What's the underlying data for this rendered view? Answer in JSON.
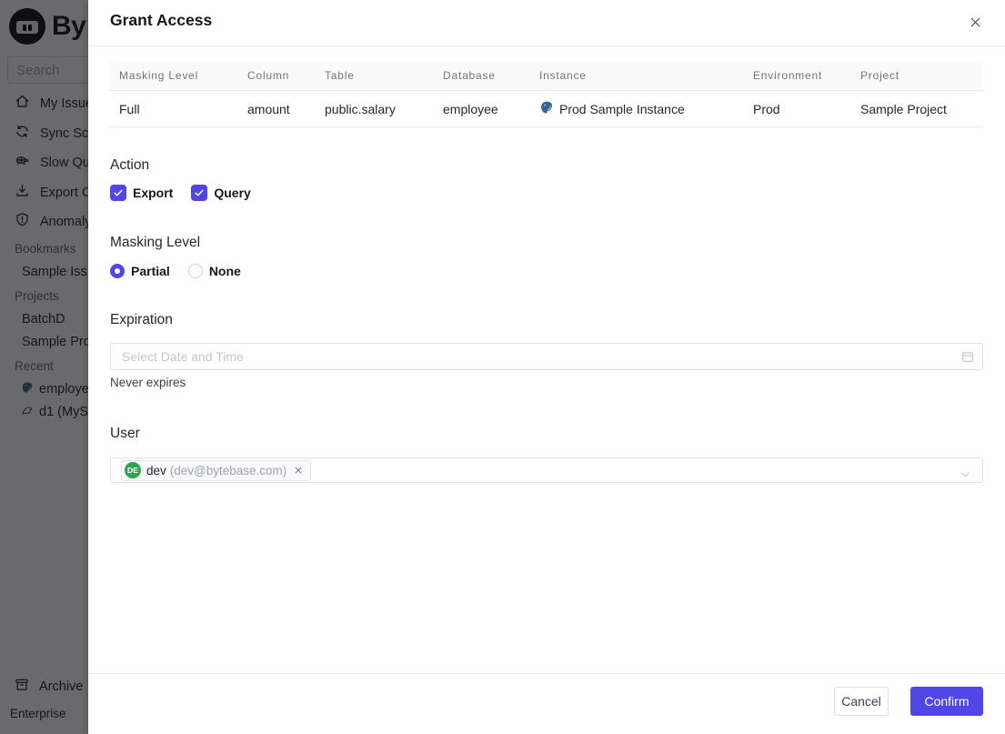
{
  "colors": {
    "accent": "#4f46e5",
    "avatar_green": "#2da44e",
    "postgres_blue": "#336791"
  },
  "sidebar": {
    "brand": "By",
    "search": {
      "placeholder": "Search"
    },
    "nav": [
      {
        "icon": "home-icon",
        "label": "My Issue"
      },
      {
        "icon": "sync-icon",
        "label": "Sync Sc"
      },
      {
        "icon": "turtle-icon",
        "label": "Slow Qu"
      },
      {
        "icon": "download-icon",
        "label": "Export C"
      },
      {
        "icon": "shield-icon",
        "label": "Anomaly"
      }
    ],
    "sections": {
      "bookmarks": "Bookmarks",
      "projects": "Projects",
      "recent": "Recent"
    },
    "bookmarks_items": [
      {
        "label": "Sample Iss"
      }
    ],
    "projects_items": [
      {
        "label": "BatchD"
      },
      {
        "label": "Sample Pro"
      }
    ],
    "recent_items": [
      {
        "icon": "postgres-icon",
        "label": "employee"
      },
      {
        "icon": "mysql-icon",
        "label": "d1 (MyS"
      }
    ],
    "archive_label": "Archive",
    "plan_label": "Enterprise"
  },
  "modal": {
    "title": "Grant Access",
    "close_icon": "close-icon",
    "table": {
      "headers": [
        "Masking Level",
        "Column",
        "Table",
        "Database",
        "Instance",
        "Environment",
        "Project"
      ],
      "row": {
        "masking_level": "Full",
        "column": "amount",
        "table": "public.salary",
        "database": "employee",
        "instance_icon": "postgres-icon",
        "instance": "Prod Sample Instance",
        "environment": "Prod",
        "project": "Sample Project"
      }
    },
    "action": {
      "label": "Action",
      "options": [
        {
          "label": "Export",
          "checked": true
        },
        {
          "label": "Query",
          "checked": true
        }
      ]
    },
    "masking": {
      "label": "Masking Level",
      "options": [
        {
          "label": "Partial",
          "selected": true
        },
        {
          "label": "None",
          "selected": false
        }
      ]
    },
    "expiration": {
      "label": "Expiration",
      "placeholder": "Select Date and Time",
      "icon": "calendar-icon",
      "hint": "Never expires"
    },
    "user": {
      "label": "User",
      "chevron_icon": "chevron-down-icon",
      "selected": {
        "initials": "DE",
        "name": "dev",
        "email": "(dev@bytebase.com)",
        "remove_icon": "close-icon"
      }
    },
    "footer": {
      "cancel": "Cancel",
      "confirm": "Confirm"
    }
  }
}
